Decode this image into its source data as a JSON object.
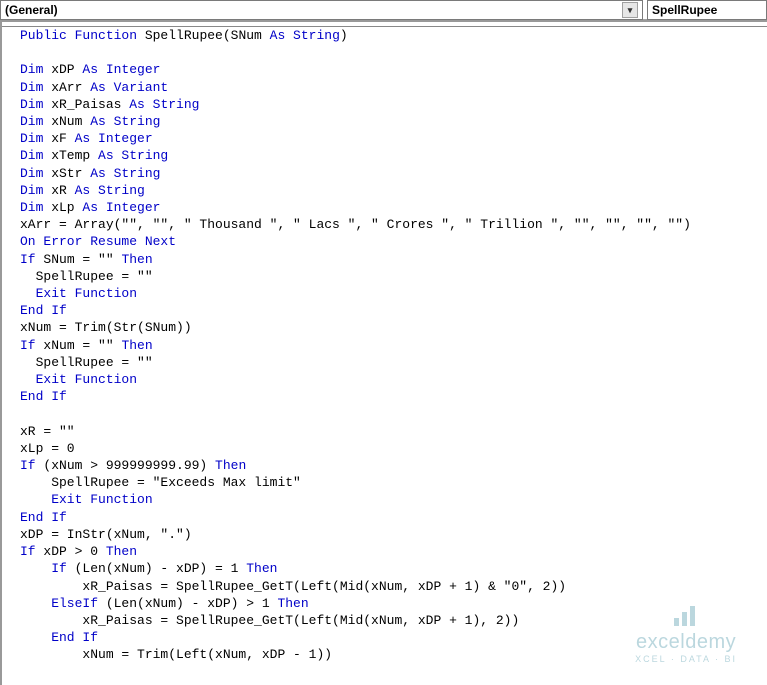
{
  "dropdowns": {
    "left": "(General)",
    "right": "SpellRupee"
  },
  "code": {
    "l01a": "Public Function",
    "l01b": " SpellRupee(SNum ",
    "l01c": "As String",
    "l01d": ")",
    "blank1": "",
    "l02a": "Dim",
    "l02b": " xDP ",
    "l02c": "As Integer",
    "l03a": "Dim",
    "l03b": " xArr ",
    "l03c": "As Variant",
    "l04a": "Dim",
    "l04b": " xR_Paisas ",
    "l04c": "As String",
    "l05a": "Dim",
    "l05b": " xNum ",
    "l05c": "As String",
    "l06a": "Dim",
    "l06b": " xF ",
    "l06c": "As Integer",
    "l07a": "Dim",
    "l07b": " xTemp ",
    "l07c": "As String",
    "l08a": "Dim",
    "l08b": " xStr ",
    "l08c": "As String",
    "l09a": "Dim",
    "l09b": " xR ",
    "l09c": "As String",
    "l10a": "Dim",
    "l10b": " xLp ",
    "l10c": "As Integer",
    "l11": "xArr = Array(\"\", \"\", \" Thousand \", \" Lacs \", \" Crores \", \" Trillion \", \"\", \"\", \"\", \"\")",
    "l12": "On Error Resume Next",
    "l13a": "If",
    "l13b": " SNum = \"\" ",
    "l13c": "Then",
    "l14": "  SpellRupee = \"\"",
    "l15": "  Exit Function",
    "l16": "End If",
    "l17": "xNum = Trim(Str(SNum))",
    "l18a": "If",
    "l18b": " xNum = \"\" ",
    "l18c": "Then",
    "l19": "  SpellRupee = \"\"",
    "l20": "  Exit Function",
    "l21": "End If",
    "blank2": "",
    "l22": "xR = \"\"",
    "l23": "xLp = 0",
    "l24a": "If",
    "l24b": " (xNum > 999999999.99) ",
    "l24c": "Then",
    "l25": "    SpellRupee = \"Exceeds Max limit\"",
    "l26": "    Exit Function",
    "l27": "End If",
    "l28": "xDP = InStr(xNum, \".\")",
    "l29a": "If",
    "l29b": " xDP > 0 ",
    "l29c": "Then",
    "l30a": "    If",
    "l30b": " (Len(xNum) - xDP) = 1 ",
    "l30c": "Then",
    "l31": "        xR_Paisas = SpellRupee_GetT(Left(Mid(xNum, xDP + 1) & \"0\", 2))",
    "l32a": "    ElseIf",
    "l32b": " (Len(xNum) - xDP) > 1 ",
    "l32c": "Then",
    "l33": "        xR_Paisas = SpellRupee_GetT(Left(Mid(xNum, xDP + 1), 2))",
    "l34": "    End If",
    "l35": "        xNum = Trim(Left(xNum, xDP - 1))"
  },
  "watermark": {
    "brand": "exceldemy",
    "sub": "XCEL · DATA · BI"
  }
}
